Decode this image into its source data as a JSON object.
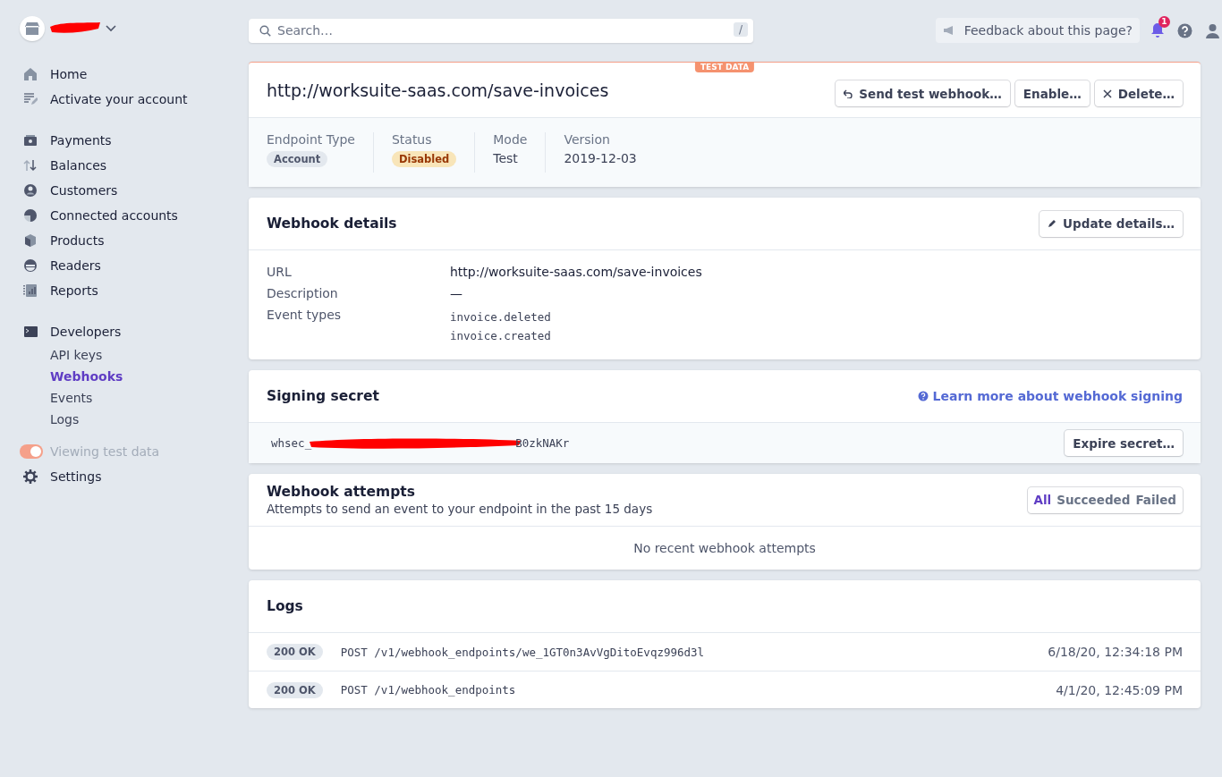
{
  "sidebar": {
    "groups": [
      [
        {
          "label": "Home",
          "selected": false
        },
        {
          "label": "Activate your account",
          "selected": false
        }
      ],
      [
        {
          "label": "Payments",
          "selected": false
        },
        {
          "label": "Balances",
          "selected": false
        },
        {
          "label": "Customers",
          "selected": false
        },
        {
          "label": "Connected accounts",
          "selected": false
        },
        {
          "label": "Products",
          "selected": false
        },
        {
          "label": "Readers",
          "selected": false
        },
        {
          "label": "Reports",
          "selected": false
        }
      ],
      [
        {
          "label": "Developers",
          "selected": false,
          "children": [
            {
              "label": "API keys",
              "selected": false
            },
            {
              "label": "Webhooks",
              "selected": true
            },
            {
              "label": "Events",
              "selected": false
            },
            {
              "label": "Logs",
              "selected": false
            }
          ]
        }
      ]
    ],
    "test_toggle": {
      "label": "Viewing test data",
      "on": true
    },
    "settings": {
      "label": "Settings"
    }
  },
  "topbar": {
    "search": {
      "placeholder": "Search…",
      "shortcut": "/"
    },
    "feedback": "Feedback about this page?",
    "notifications": "1"
  },
  "endpoint": {
    "badge": "TEST DATA",
    "url": "http://worksuite-saas.com/save-invoices",
    "actions": [
      "Send test webhook…",
      "Enable…",
      "Delete…"
    ],
    "meta": [
      {
        "label": "Endpoint Type",
        "value": "Account",
        "kind": "neutral"
      },
      {
        "label": "Status",
        "value": "Disabled",
        "kind": "warning"
      },
      {
        "label": "Mode",
        "value": "Test",
        "kind": "plain"
      },
      {
        "label": "Version",
        "value": "2019-12-03",
        "kind": "plain"
      }
    ]
  },
  "details": {
    "title": "Webhook details",
    "action": "Update details…",
    "rows": [
      {
        "label": "URL",
        "values": [
          "http://worksuite-saas.com/save-invoices"
        ],
        "kind": "text"
      },
      {
        "label": "Description",
        "values": [
          "—"
        ],
        "kind": "text"
      },
      {
        "label": "Event types",
        "values": [
          "invoice.deleted",
          "invoice.created"
        ],
        "kind": "code"
      }
    ]
  },
  "signing": {
    "title": "Signing secret",
    "link": "Learn more about webhook signing",
    "secret_start": "whsec_",
    "secret_end": "B0zkNAKr",
    "action": "Expire secret…"
  },
  "attempts": {
    "title": "Webhook attempts",
    "subtitle": "Attempts to send an event to your endpoint in the past 15 days",
    "filters": [
      {
        "label": "All",
        "selected": true
      },
      {
        "label": "Succeeded",
        "selected": false
      },
      {
        "label": "Failed",
        "selected": false
      }
    ],
    "empty": "No recent webhook attempts"
  },
  "logs": {
    "title": "Logs",
    "rows": [
      {
        "status": "200 OK",
        "request": "POST /v1/webhook_endpoints/we_1GT0n3AvVgDitoEvqz996d3l",
        "time": "6/18/20, 12:34:18 PM"
      },
      {
        "status": "200 OK",
        "request": "POST /v1/webhook_endpoints",
        "time": "4/1/20, 12:45:09 PM"
      }
    ]
  }
}
